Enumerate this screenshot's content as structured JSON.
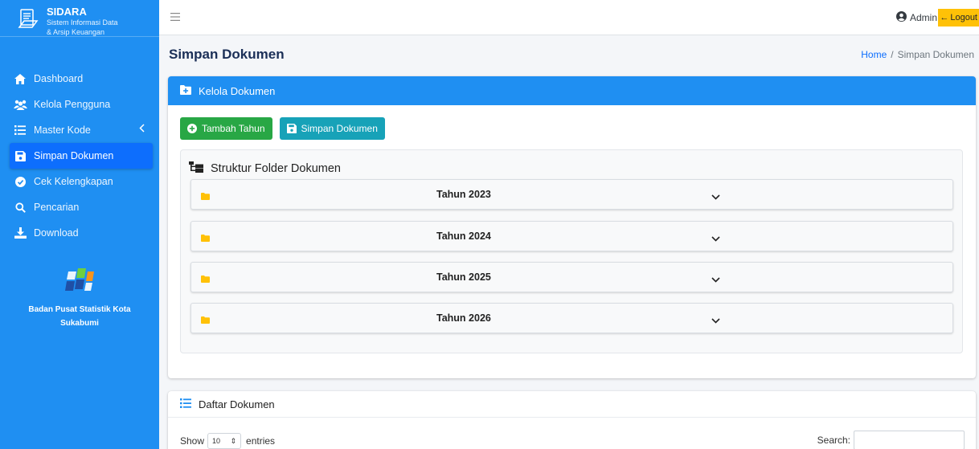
{
  "app": {
    "title": "SIDARA",
    "subtitle_line1": "Sistem Informasi Data",
    "subtitle_line2": "& Arsip Keuangan"
  },
  "sidebar": {
    "items": [
      {
        "label": "Dashboard",
        "icon": "home-icon"
      },
      {
        "label": "Kelola Pengguna",
        "icon": "users-icon"
      },
      {
        "label": "Master Kode",
        "icon": "list-icon"
      },
      {
        "label": "Simpan Dokumen",
        "icon": "save-icon",
        "active": true
      },
      {
        "label": "Cek Kelengkapan",
        "icon": "check-circle-icon"
      },
      {
        "label": "Pencarian",
        "icon": "search-icon"
      },
      {
        "label": "Download",
        "icon": "download-icon"
      }
    ],
    "org_name": "Badan Pusat Statistik Kota Sukabumi"
  },
  "topbar": {
    "user_name": "Admin",
    "logout_label": "Logout"
  },
  "page": {
    "title": "Simpan Dokumen",
    "breadcrumb_home": "Home",
    "breadcrumb_sep": "/",
    "breadcrumb_current": "Simpan Dokumen"
  },
  "manage_card": {
    "header": "Kelola Dokumen",
    "add_year_label": "Tambah Tahun",
    "save_doc_label": "Simpan Dokumen",
    "folder_title": "Struktur Folder Dokumen",
    "years": [
      "Tahun 2023",
      "Tahun 2024",
      "Tahun 2025",
      "Tahun 2026"
    ]
  },
  "list_card": {
    "header": "Daftar Dokumen",
    "show_label": "Show",
    "entries_value": "10",
    "entries_label": "entries",
    "search_label": "Search:"
  },
  "colors": {
    "sidebar": "#1f8ff2",
    "active_item": "#0d6efd",
    "success": "#28a745",
    "info": "#17a2b8",
    "warning": "#ffc107",
    "folder": "#ffc107"
  }
}
